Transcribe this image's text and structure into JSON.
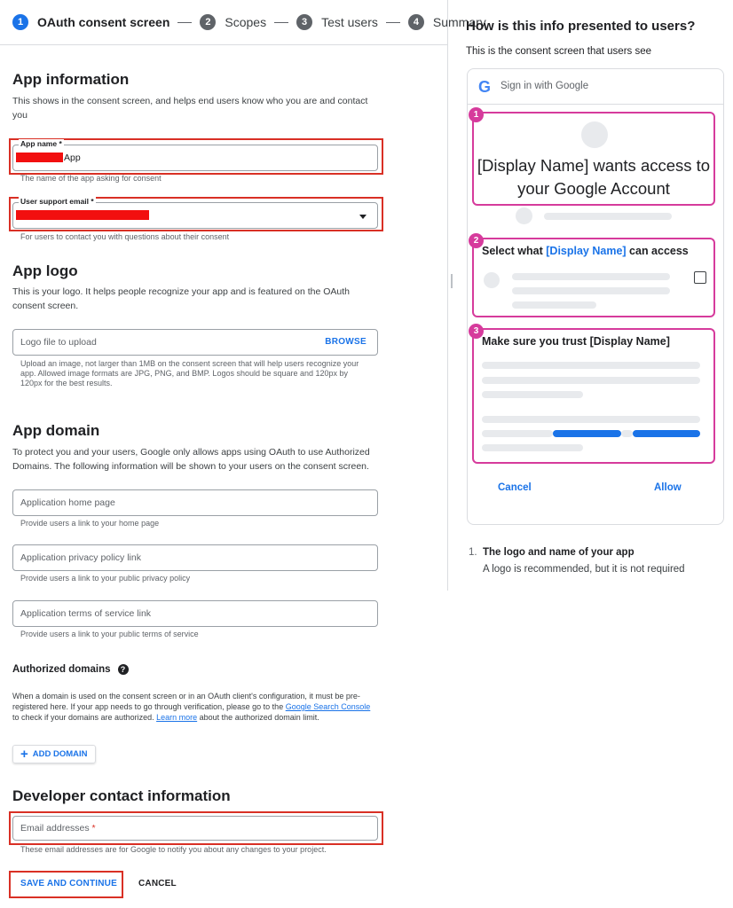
{
  "stepper": {
    "steps": [
      {
        "num": "1",
        "label": "OAuth consent screen"
      },
      {
        "num": "2",
        "label": "Scopes"
      },
      {
        "num": "3",
        "label": "Test users"
      },
      {
        "num": "4",
        "label": "Summary"
      }
    ]
  },
  "app_info": {
    "title": "App information",
    "desc": "This shows in the consent screen, and helps end users know who you are and contact you",
    "app_name_label": "App name *",
    "app_name_suffix": "App",
    "app_name_hint": "The name of the app asking for consent",
    "support_email_label": "User support email *",
    "support_email_hint": "For users to contact you with questions about their consent"
  },
  "app_logo": {
    "title": "App logo",
    "desc": "This is your logo. It helps people recognize your app and is featured on the OAuth consent screen.",
    "placeholder": "Logo file to upload",
    "browse": "BROWSE",
    "hint": "Upload an image, not larger than 1MB on the consent screen that will help users recognize your app. Allowed image formats are JPG, PNG, and BMP. Logos should be square and 120px by 120px for the best results."
  },
  "app_domain": {
    "title": "App domain",
    "desc": "To protect you and your users, Google only allows apps using OAuth to use Authorized Domains. The following information will be shown to your users on the consent screen.",
    "home_placeholder": "Application home page",
    "home_hint": "Provide users a link to your home page",
    "privacy_placeholder": "Application privacy policy link",
    "privacy_hint": "Provide users a link to your public privacy policy",
    "tos_placeholder": "Application terms of service link",
    "tos_hint": "Provide users a link to your public terms of service"
  },
  "authorized_domains": {
    "title": "Authorized domains",
    "help": "?",
    "desc_1": "When a domain is used on the consent screen or in an OAuth client's configuration, it must be pre-registered here. If your app needs to go through verification, please go to the",
    "link_1": "Google Search Console",
    "desc_2": "to check if your domains are authorized.",
    "link_2": "Learn more",
    "desc_3": "about the authorized domain limit.",
    "add_button": "ADD DOMAIN"
  },
  "developer": {
    "title": "Developer contact information",
    "email_placeholder": "Email addresses",
    "required_mark": "*",
    "hint": "These email addresses are for Google to notify you about any changes to your project."
  },
  "actions": {
    "save": "SAVE AND CONTINUE",
    "cancel": "CANCEL"
  },
  "preview": {
    "title": "How is this info presented to users?",
    "subtitle": "This is the consent screen that users see",
    "sign_in": "Sign in with Google",
    "google_g": "G",
    "n1": "1",
    "n2": "2",
    "n3": "3",
    "wants_access": "[Display Name] wants access to your Google Account",
    "select_prefix": "Select what ",
    "select_name": "[Display Name]",
    "select_suffix": " can access",
    "trust": "Make sure you trust [Display Name]",
    "cancel": "Cancel",
    "allow": "Allow",
    "list_num": "1.",
    "list_title": "The logo and name of your app",
    "list_desc": "A logo is recommended, but it is not required"
  },
  "colors": {
    "accent": "#1a73e8",
    "highlight": "#d93025",
    "preview_highlight": "#d63b9c",
    "redaction": "#f20f0f"
  }
}
